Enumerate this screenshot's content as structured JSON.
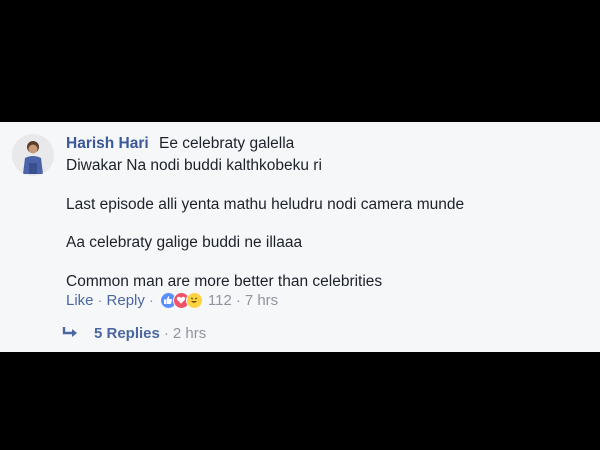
{
  "comment": {
    "author": "Harish Hari",
    "lines": [
      "Ee celebraty galella",
      "Diwakar Na nodi buddi kalthkobeku ri",
      "Last episode alli yenta mathu heludru nodi camera munde",
      "Aa celebraty galige buddi ne illaaa",
      "Common man are more better than celebrities"
    ],
    "actions": {
      "like_label": "Like",
      "reply_label": "Reply",
      "reactions": [
        "like-icon",
        "love-icon",
        "haha-icon"
      ],
      "reaction_count": "112",
      "time": "7 hrs",
      "separator": "·"
    },
    "replies": {
      "label": "5 Replies",
      "time": "2 hrs"
    }
  },
  "colors": {
    "name": "#3b5998",
    "link": "#4b67a1",
    "meta": "#90949c",
    "text": "#1d2129",
    "panel": "#f6f7f9",
    "background": "#000000"
  }
}
